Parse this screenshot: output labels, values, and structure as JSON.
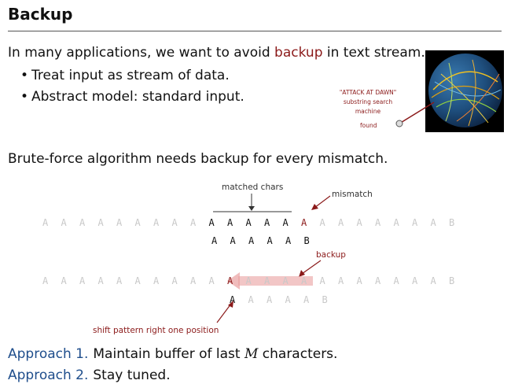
{
  "slide": {
    "title": "Backup",
    "intro_pre": "In many applications, we want to avoid ",
    "intro_highlight": "backup",
    "intro_post": " in text stream.",
    "bullets": [
      "Treat input as stream of data.",
      "Abstract model: standard input."
    ],
    "machine_label_1": "\"ATTACK AT DAWN\"",
    "machine_label_2": "substring search",
    "machine_label_3": "machine",
    "found_label": "found",
    "brute_force": "Brute-force algorithm needs backup for every mismatch.",
    "diagram": {
      "matched_chars_label": "matched chars",
      "mismatch_label": "mismatch",
      "backup_label": "backup",
      "shift_label": "shift pattern right one position",
      "text_row": [
        "A",
        "A",
        "A",
        "A",
        "A",
        "A",
        "A",
        "A",
        "A",
        "A",
        "A",
        "A",
        "A",
        "A",
        "A",
        "A",
        "A",
        "A",
        "A",
        "A",
        "A",
        "A",
        "B"
      ],
      "pattern_row": [
        "A",
        "A",
        "A",
        "A",
        "A",
        "B"
      ],
      "text_row_2": [
        "A",
        "A",
        "A",
        "A",
        "A",
        "A",
        "A",
        "A",
        "A",
        "A",
        "A",
        "A",
        "A",
        "A",
        "A",
        "A",
        "A",
        "A",
        "A",
        "A",
        "A",
        "A",
        "B"
      ],
      "pattern_row_2": [
        "A",
        "A",
        "A",
        "A",
        "A",
        "B"
      ]
    },
    "approach1_label": "Approach 1.",
    "approach1_text_pre": "Maintain buffer of last ",
    "approach1_var": "M",
    "approach1_text_post": " characters.",
    "approach2_label": "Approach 2.",
    "approach2_text": "Stay tuned."
  },
  "colors": {
    "accent": "#8b1a1a",
    "approach": "#1f4e8c",
    "faded_text": "#c8c8c8"
  }
}
